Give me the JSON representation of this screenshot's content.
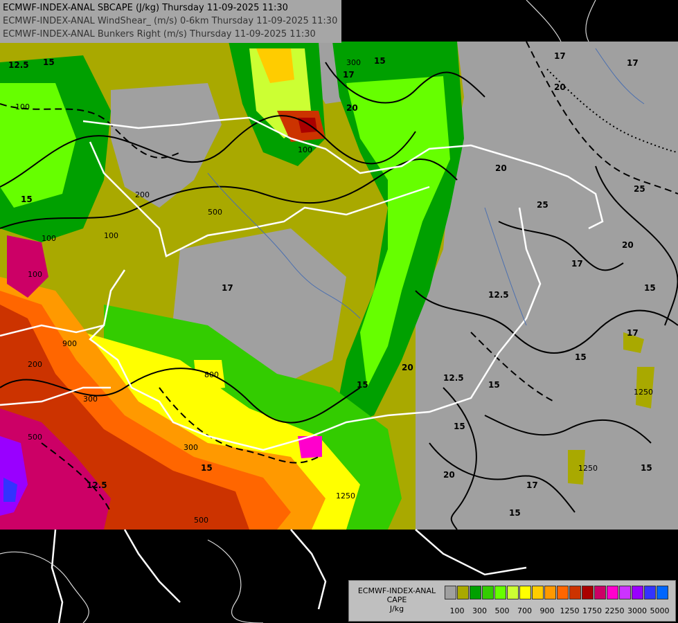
{
  "header": {
    "lines": [
      {
        "text": "ECMWF-INDEX-ANAL SBCAPE (J/kg) Thursday 11-09-2025 11:30",
        "color": "#000000"
      },
      {
        "text": "ECMWF-INDEX-ANAL WindShear_ (m/s) 0-6km Thursday 11-09-2025 11:30",
        "color": "#333333"
      },
      {
        "text": "ECMWF-INDEX-ANAL Bunkers Right (m/s) Thursday 11-09-2025 11:30",
        "color": "#333333"
      }
    ]
  },
  "legend": {
    "title_lines": [
      "ECMWF-INDEX-ANAL",
      "CAPE",
      "J/kg"
    ],
    "colors": [
      "#a0a0a0",
      "#a9a900",
      "#00a000",
      "#33cc00",
      "#66ff00",
      "#ccff33",
      "#ffff00",
      "#ffcc00",
      "#ff9900",
      "#ff6600",
      "#cc3300",
      "#aa0000",
      "#cc0066",
      "#ff00cc",
      "#cc33ff",
      "#9900ff",
      "#3333ff",
      "#0066ff",
      "#00ccff",
      "#33ffff",
      "#ccffff",
      "#ffffff"
    ],
    "tick_labels": [
      "100",
      "300",
      "500",
      "700",
      "900",
      "1250",
      "1750",
      "2250",
      "3000",
      "5000"
    ]
  },
  "contour_labels": {
    "windshear": [
      "12.5",
      "15",
      "15",
      "17",
      "15",
      "20",
      "25",
      "25",
      "20",
      "17",
      "15",
      "12.5",
      "15",
      "17",
      "15",
      "12.5",
      "15",
      "20",
      "17",
      "15",
      "15",
      "17",
      "20",
      "17",
      "15",
      "12.5",
      "17",
      "15",
      "20",
      "20"
    ],
    "cape": [
      "100",
      "100",
      "100",
      "100",
      "100",
      "200",
      "300",
      "200",
      "300",
      "300",
      "500",
      "500",
      "900",
      "800",
      "1250",
      "1250",
      "1250",
      "500",
      "300",
      "300",
      "900",
      "100",
      "100",
      "100"
    ]
  },
  "map_colors": {
    "ocean": "#000000",
    "no_data": "#a0a0a0",
    "border": "#ffffff",
    "coast": "#d8d8d8",
    "river": "#4a6fb0"
  }
}
